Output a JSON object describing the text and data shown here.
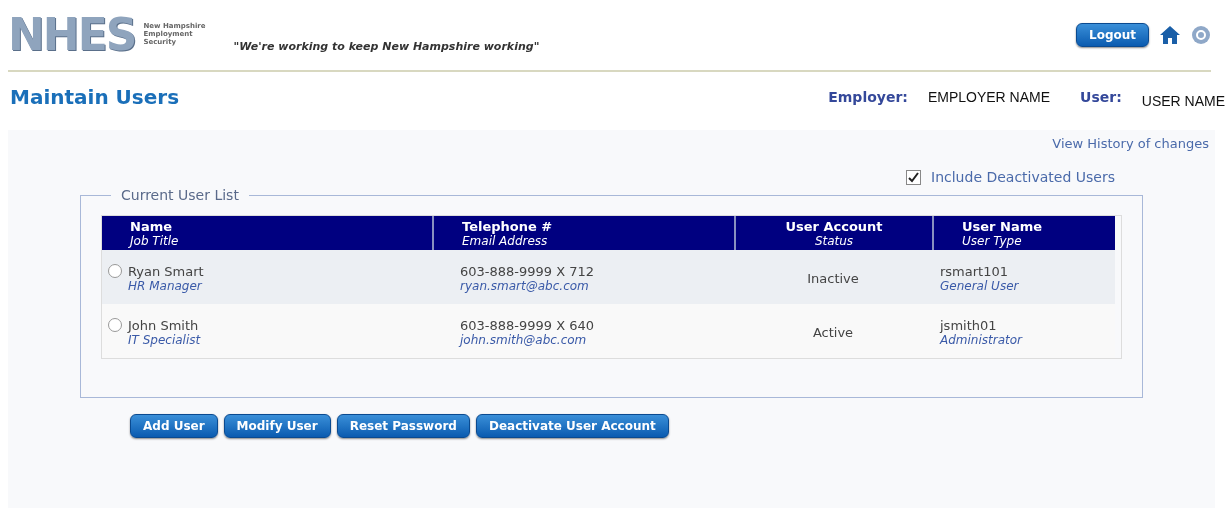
{
  "header": {
    "logo_text": "NHES",
    "logo_caption": [
      "New Hampshire",
      "Employment",
      "Security"
    ],
    "tagline": "\"We're working to keep New Hampshire working\"",
    "logout": "Logout"
  },
  "page": {
    "title": "Maintain Users",
    "employer_label": "Employer:",
    "employer_value": "EMPLOYER NAME",
    "user_label": "User:",
    "user_value": "USER NAME"
  },
  "history_link": "View History of changes",
  "include_deactivated": {
    "label": "Include Deactivated Users",
    "checked": true
  },
  "user_list": {
    "legend": "Current User List",
    "columns": [
      {
        "main": "Name",
        "sub": "Job Title"
      },
      {
        "main": "Telephone #",
        "sub": "Email Address"
      },
      {
        "main": "User Account",
        "sub": "Status"
      },
      {
        "main": "User Name",
        "sub": "User Type"
      }
    ],
    "rows": [
      {
        "name": "Ryan Smart",
        "job_title": "HR Manager",
        "phone": "603-888-9999 X 712",
        "email": "ryan.smart@abc.com",
        "status": "Inactive",
        "username": "rsmart101",
        "user_type": "General User",
        "selected": false
      },
      {
        "name": "John Smith",
        "job_title": "IT Specialist",
        "phone": "603-888-9999 X 640",
        "email": "john.smith@abc.com",
        "status": "Active",
        "username": "jsmith01",
        "user_type": "Administrator",
        "selected": false
      }
    ]
  },
  "buttons": [
    "Add User",
    "Modify User",
    "Reset Password",
    "Deactivate User Account"
  ]
}
